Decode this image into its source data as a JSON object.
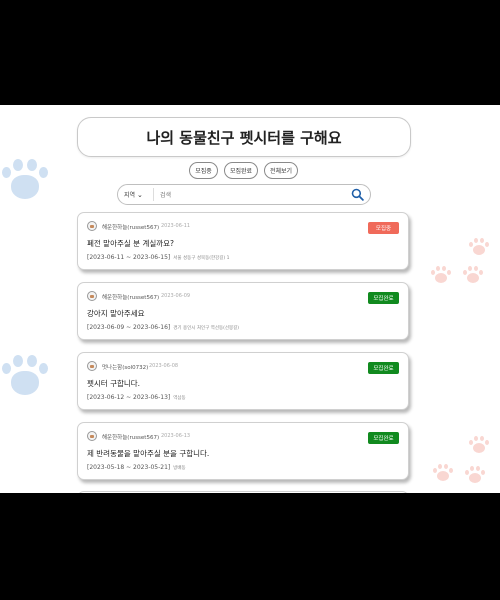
{
  "colors": {
    "recruiting": "#f06a5a",
    "closed": "#118a1f",
    "paw_blue": "#cfe0f2",
    "paw_pink": "#f9d7d2"
  },
  "header": {
    "title": "나의 동물친구 펫시터를 구해요"
  },
  "filters": [
    {
      "label": "모집중"
    },
    {
      "label": "모집완료"
    },
    {
      "label": "전체보기"
    }
  ],
  "search": {
    "region_label": "지역",
    "placeholder": "검색",
    "icon": "search-icon"
  },
  "posts": [
    {
      "author": "해운한하늘(russet567)",
      "date": "2023-06-11",
      "badge": "모집중",
      "status": "recruiting",
      "title": "폐전 맡아주실 분 계실까요?",
      "period": "[2023-06-11 ~ 2023-06-15]",
      "location": "서울 성동구 성북동(한강길) 1"
    },
    {
      "author": "해운한하늘(russet567)",
      "date": "2023-06-09",
      "badge": "모집완료",
      "status": "closed",
      "title": "강아지 맡아주세요",
      "period": "[2023-06-09 ~ 2023-06-16]",
      "location": "경기 용인시 처인구 역선동(선봉길)"
    },
    {
      "author": "멋나는함(sol0732)",
      "date": "2023-06-08",
      "badge": "모집완료",
      "status": "closed",
      "title": "펫시터 구합니다.",
      "period": "[2023-06-12 ~ 2023-06-13]",
      "location": "역삼동"
    },
    {
      "author": "해운한하늘(russet567)",
      "date": "2023-06-13",
      "badge": "모집완료",
      "status": "closed",
      "title": "제 반려동물을 맡아주실 분을 구합니다.",
      "period": "[2023-05-18 ~ 2023-05-21]",
      "location": "방배동"
    }
  ]
}
